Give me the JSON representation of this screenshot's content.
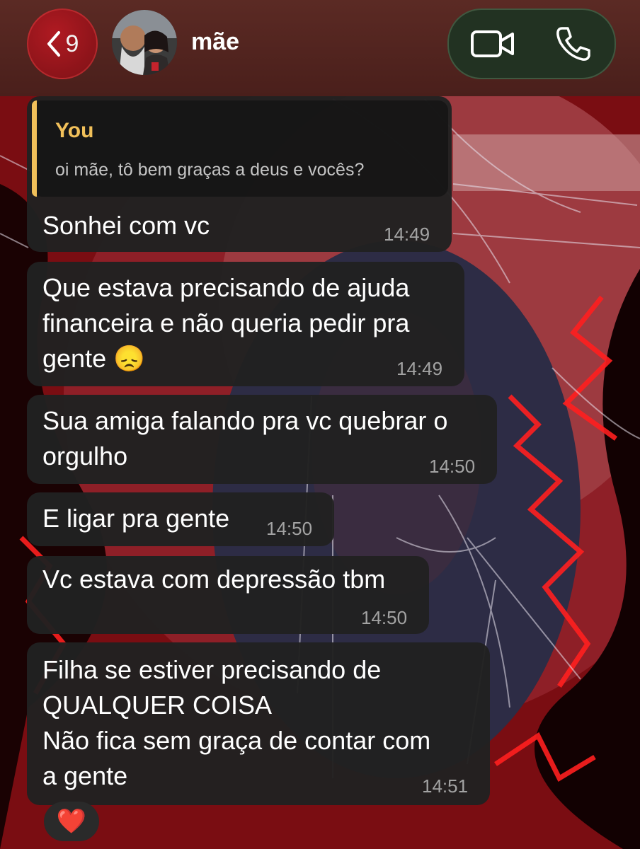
{
  "header": {
    "unread_count": "9",
    "contact_name": "mãe",
    "icons": {
      "back": "chevron-left-icon",
      "video": "video-camera-icon",
      "phone": "phone-icon"
    }
  },
  "colors": {
    "header_bg": "#4f221e",
    "back_button": "#a3151c",
    "bubble_bg": "#212121",
    "reply_accent": "#f1c05a",
    "timestamp": "#a3a3a3"
  },
  "messages": [
    {
      "reply_to": {
        "author": "You",
        "text": "oi mãe, tô bem graças a deus e vocês?"
      },
      "text": "Sonhei com vc",
      "time": "14:49"
    },
    {
      "text": "Que estava precisando de ajuda\nfinanceira e não queria pedir pra\ngente 😞",
      "time": "14:49"
    },
    {
      "text": "Sua amiga falando pra vc quebrar o\norgulho",
      "time": "14:50"
    },
    {
      "text": "E ligar pra gente",
      "time": "14:50"
    },
    {
      "text": "Vc estava com depressão tbm",
      "time": "14:50"
    },
    {
      "text": "Filha se estiver precisando de\nQUALQUER COISA\nNão fica sem graça de contar com\na gente",
      "time": "14:51",
      "reaction": "❤️"
    }
  ]
}
